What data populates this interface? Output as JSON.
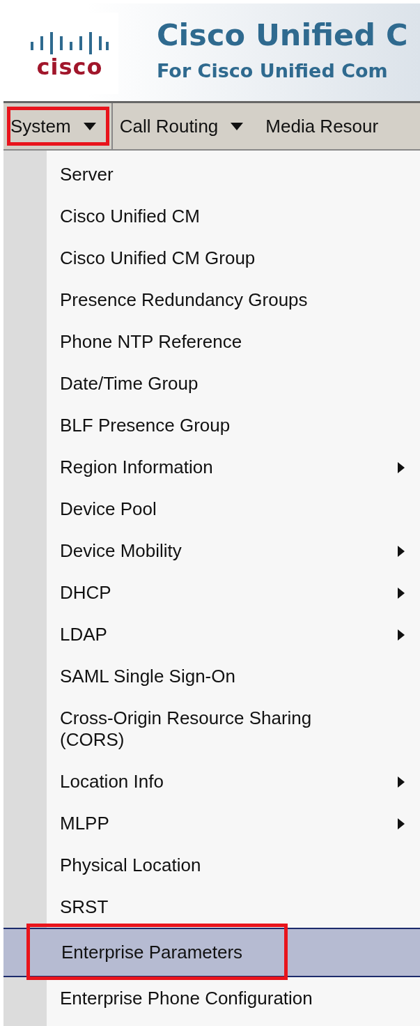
{
  "header": {
    "logo_text": "cisco",
    "title": "Cisco Unified C",
    "subtitle": "For Cisco Unified Com"
  },
  "menu_bar": [
    {
      "label": "System",
      "has_dropdown": true,
      "highlighted": true
    },
    {
      "label": "Call Routing",
      "has_dropdown": true,
      "highlighted": false
    },
    {
      "label": "Media Resour",
      "has_dropdown": false,
      "highlighted": false
    }
  ],
  "dropdown_items": [
    {
      "label": "Server",
      "has_submenu": false,
      "selected": false,
      "highlighted": false
    },
    {
      "label": "Cisco Unified CM",
      "has_submenu": false,
      "selected": false,
      "highlighted": false
    },
    {
      "label": "Cisco Unified CM Group",
      "has_submenu": false,
      "selected": false,
      "highlighted": false
    },
    {
      "label": "Presence Redundancy Groups",
      "has_submenu": false,
      "selected": false,
      "highlighted": false
    },
    {
      "label": "Phone NTP Reference",
      "has_submenu": false,
      "selected": false,
      "highlighted": false
    },
    {
      "label": "Date/Time Group",
      "has_submenu": false,
      "selected": false,
      "highlighted": false
    },
    {
      "label": "BLF Presence Group",
      "has_submenu": false,
      "selected": false,
      "highlighted": false
    },
    {
      "label": "Region Information",
      "has_submenu": true,
      "selected": false,
      "highlighted": false
    },
    {
      "label": "Device Pool",
      "has_submenu": false,
      "selected": false,
      "highlighted": false
    },
    {
      "label": "Device Mobility",
      "has_submenu": true,
      "selected": false,
      "highlighted": false
    },
    {
      "label": "DHCP",
      "has_submenu": true,
      "selected": false,
      "highlighted": false
    },
    {
      "label": "LDAP",
      "has_submenu": true,
      "selected": false,
      "highlighted": false
    },
    {
      "label": "SAML Single Sign-On",
      "has_submenu": false,
      "selected": false,
      "highlighted": false
    },
    {
      "label": "Cross-Origin Resource Sharing (CORS)",
      "has_submenu": false,
      "selected": false,
      "highlighted": false
    },
    {
      "label": "Location Info",
      "has_submenu": true,
      "selected": false,
      "highlighted": false
    },
    {
      "label": "MLPP",
      "has_submenu": true,
      "selected": false,
      "highlighted": false
    },
    {
      "label": "Physical Location",
      "has_submenu": false,
      "selected": false,
      "highlighted": false
    },
    {
      "label": "SRST",
      "has_submenu": false,
      "selected": false,
      "highlighted": false
    },
    {
      "label": "Enterprise Parameters",
      "has_submenu": false,
      "selected": true,
      "highlighted": true
    },
    {
      "label": "Enterprise Phone Configuration",
      "has_submenu": false,
      "selected": false,
      "highlighted": false
    }
  ]
}
